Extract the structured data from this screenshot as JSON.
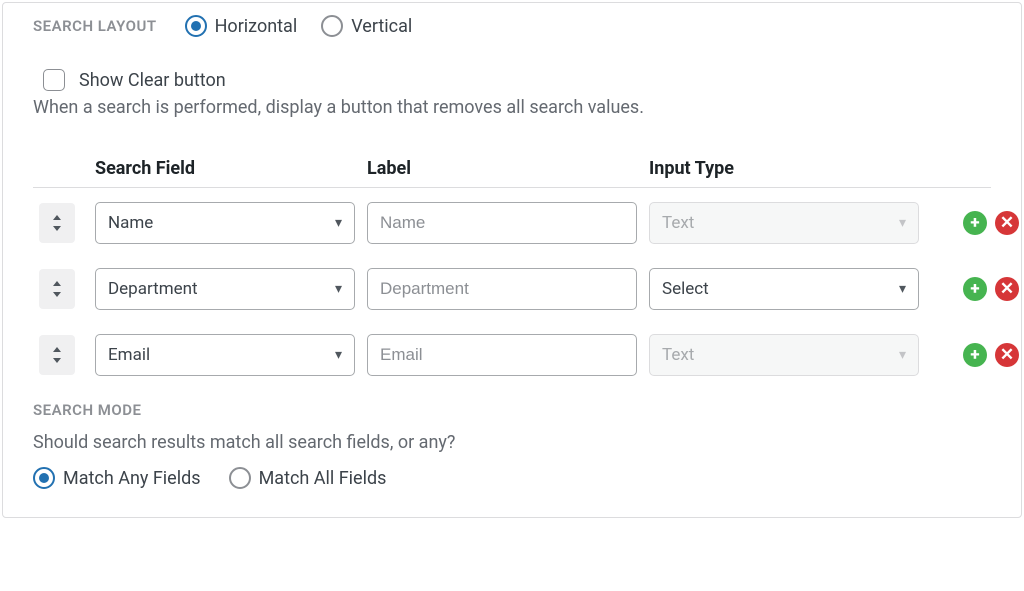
{
  "layout": {
    "section_label": "Search Layout",
    "options": {
      "horizontal": "Horizontal",
      "vertical": "Vertical"
    },
    "selected": "horizontal"
  },
  "clear_button": {
    "label": "Show Clear button",
    "help": "When a search is performed, display a button that removes all search values.",
    "checked": false
  },
  "table": {
    "headers": {
      "search_field": "Search Field",
      "label": "Label",
      "input_type": "Input Type"
    },
    "rows": [
      {
        "search_field": "Name",
        "label_placeholder": "Name",
        "input_type": "Text",
        "input_type_disabled": true
      },
      {
        "search_field": "Department",
        "label_placeholder": "Department",
        "input_type": "Select",
        "input_type_disabled": false
      },
      {
        "search_field": "Email",
        "label_placeholder": "Email",
        "input_type": "Text",
        "input_type_disabled": true
      }
    ]
  },
  "mode": {
    "section_label": "Search Mode",
    "help": "Should search results match all search fields, or any?",
    "options": {
      "any": "Match Any Fields",
      "all": "Match All Fields"
    },
    "selected": "any"
  },
  "icons": {
    "add": "+",
    "remove": "✕"
  }
}
